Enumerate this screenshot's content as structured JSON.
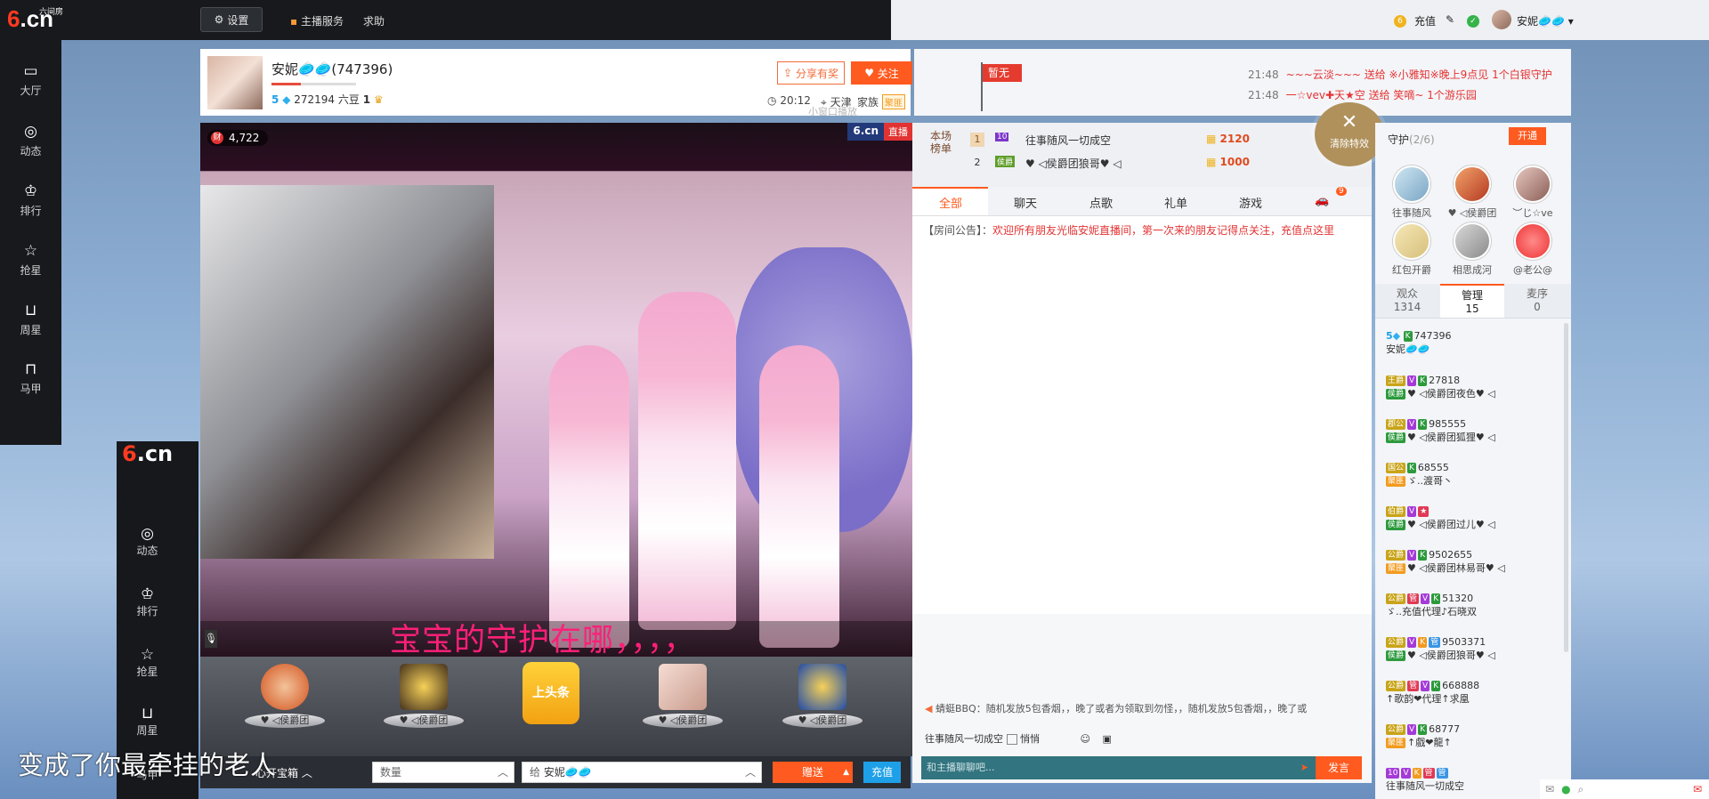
{
  "topbar": {
    "logo": "6.cn",
    "logo_sub": "六间房",
    "settings_label": "设置",
    "anchor_service": "主播服务",
    "help": "求助",
    "recharge": "充值",
    "username": "安妮🥏🥏"
  },
  "sidenav": {
    "items": [
      {
        "label": "大厅",
        "icon": "tv-icon"
      },
      {
        "label": "动态",
        "icon": "compass-icon"
      },
      {
        "label": "排行",
        "icon": "crown-icon"
      },
      {
        "label": "抢星",
        "icon": "star-icon"
      },
      {
        "label": "周星",
        "icon": "basket-icon"
      },
      {
        "label": "马甲",
        "icon": "shirt-icon"
      }
    ]
  },
  "mini_nav": {
    "logo": "6.cn",
    "logo_sub": "六间房",
    "items": [
      "动态",
      "排行",
      "抢星",
      "周星",
      "马甲"
    ]
  },
  "anchor": {
    "name": "安妮🥏🥏(747396)",
    "level": "5",
    "beans": "272194 六豆",
    "crown_count": "1",
    "level_progress": 0.35,
    "share_label": "分享有奖",
    "follow_label": "关注",
    "time": "20:12",
    "city": "天津",
    "family": "家族",
    "family_badge": "聚匪",
    "small_window": "小窗口播放"
  },
  "flag": {
    "text": "暂无"
  },
  "gift_feed": [
    {
      "time": "21:48",
      "text": "~~~云淡~~~ 送给 ※小雅知※晚上9点见 1个白银守护"
    },
    {
      "time": "21:48",
      "text": "一☆vev✚天★空 送给 笑嘀~ 1个游乐园"
    }
  ],
  "video": {
    "viewers": "4,722",
    "watermark": "6.cn",
    "live": "直播",
    "caption": "宝宝的守护在哪，，，，"
  },
  "gift_tray": [
    {
      "label": "♥ ◁侯爵团"
    },
    {
      "label": "♥ ◁侯爵团"
    },
    {
      "label": "上头条"
    },
    {
      "label": "♥ ◁侯爵团"
    },
    {
      "label": "♥ ◁侯爵团"
    }
  ],
  "send_bar": {
    "treasure": "心开宝箱",
    "quantity_placeholder": "数量",
    "to_label": "给",
    "to_user": "安妮🥏🥏",
    "give_label": "赠送",
    "recharge_label": "充值"
  },
  "overlay_lyric": "变成了你最牵挂的老人",
  "rank": {
    "label": "本场榜单",
    "rows": [
      {
        "num": "1",
        "name": "往事随风一切成空",
        "coins": "2120"
      },
      {
        "num": "2",
        "name": "♥ ◁侯爵团狼哥♥ ◁",
        "coins": "1000"
      }
    ]
  },
  "clear_fx": "清除特效",
  "chat": {
    "tabs": [
      "全部",
      "聊天",
      "点歌",
      "礼单",
      "游戏"
    ],
    "car_badge": "9",
    "notice_label": "【房间公告】：",
    "notice_text": "欢迎所有朋友光临安妮直播间，第一次来的朋友记得点关注，充值点这里",
    "system_line": "蜻蜓BBQ：随机发放5包香烟，，晚了或者为领取到勿怪，，随机发放5包香烟，，晚了或",
    "target_user": "往事随风一切成空",
    "whisper": "悄悄",
    "input_placeholder": "和主播聊聊吧...",
    "send_label": "发言"
  },
  "guard": {
    "title": "守护",
    "count": "(2/6)",
    "open_label": "开通",
    "members": [
      "往事随风",
      "♥ ◁侯爵团",
      "︶じ☆ve",
      "红包开爵",
      "相思成河",
      "@老公@"
    ]
  },
  "audience_tabs": [
    {
      "label": "观众",
      "count": "1314"
    },
    {
      "label": "管理",
      "count": "15"
    },
    {
      "label": "麦序",
      "count": "0"
    }
  ],
  "user_list": [
    {
      "id": "747396",
      "name": "安妮🥏🥏"
    },
    {
      "id": "27818",
      "name": "♥ ◁侯爵团夜色♥ ◁"
    },
    {
      "id": "985555",
      "name": "♥ ◁侯爵团狐狸♥ ◁"
    },
    {
      "id": "68555",
      "name": "ゞ..渡哥丶"
    },
    {
      "id": "",
      "name": "♥ ◁侯爵团过儿♥ ◁"
    },
    {
      "id": "9502655",
      "name": "♥ ◁侯爵团林易哥♥ ◁"
    },
    {
      "id": "51320",
      "name": "ゞ..充值代理♪石晓双"
    },
    {
      "id": "9503371",
      "name": "♥ ◁侯爵团狼哥♥ ◁"
    },
    {
      "id": "668888",
      "name": "↑歌韵❤代理↑求凰"
    },
    {
      "id": "68777",
      "name": "↑戲❤龍↑"
    },
    {
      "id": "",
      "name": "往事随风一切成空"
    }
  ]
}
